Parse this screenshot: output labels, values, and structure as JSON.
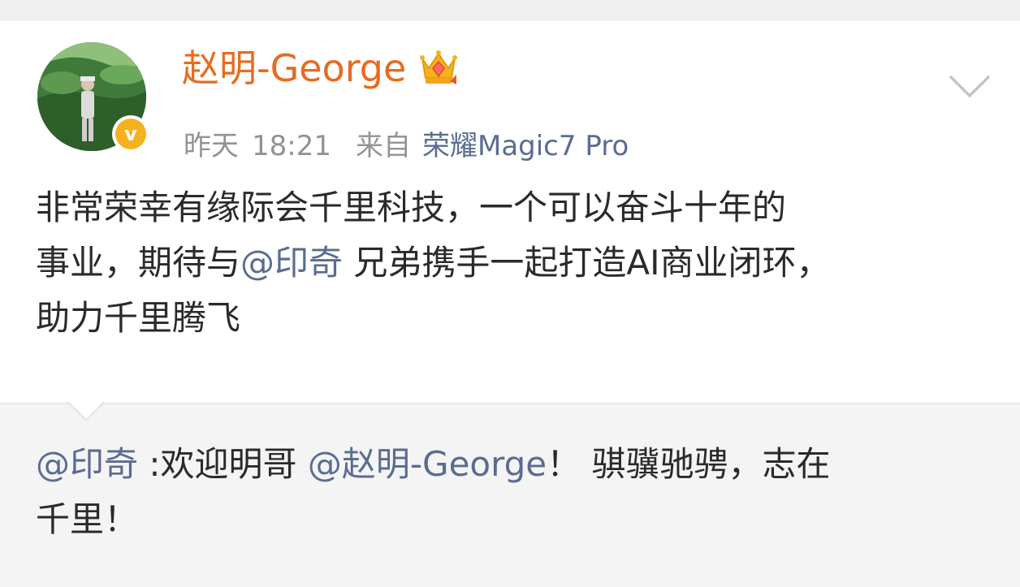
{
  "post": {
    "author": "赵明-George",
    "crown_badge": "crown-gem-icon",
    "verified_badge": "v",
    "timestamp_day": "昨天",
    "timestamp_time": "18:21",
    "source_prefix": "来自",
    "source_device": "荣耀Magic7 Pro",
    "body": {
      "line1": "非常荣幸有缘际会千里科技，一个可以奋斗十年的",
      "line2_before": "事业，期待与",
      "line2_mention": "@印奇",
      "line2_after": " 兄弟携手一起打造AI商业闭环，",
      "line3": "助力千里腾飞"
    }
  },
  "repost": {
    "mention_author": "@印奇",
    "text_before": " :欢迎明哥 ",
    "mention_target": "@赵明-George",
    "text_after": "！  骐骥驰骋，志在",
    "line2": "千里！"
  },
  "colors": {
    "username": "#e86b1f",
    "mention": "#5a6c8f",
    "meta": "#939393",
    "body_text": "#2a2a2a",
    "verified_badge": "#f6b21e",
    "repost_bg": "#f4f4f4"
  },
  "icons": {
    "more": "chevron-down-icon",
    "crown": "crown-icon",
    "verified": "verified-badge-icon"
  }
}
